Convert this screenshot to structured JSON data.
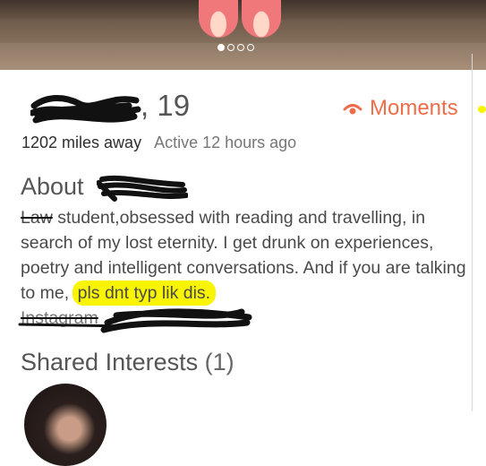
{
  "photo": {
    "dots": [
      true,
      false,
      false,
      false
    ]
  },
  "profile": {
    "name_suffix": ", 19",
    "distance": "1202 miles away",
    "active": "Active 12 hours ago"
  },
  "moments": {
    "label": "Moments",
    "color": "#ee6d4a",
    "icon": "eye-icon"
  },
  "about": {
    "heading": "About",
    "bio_struck": "Law",
    "bio_main": " student,obsessed with reading and travelling, in search of my lost eternity. I get drunk on experiences, poetry and intelligent conversations. And if you are talking to me, ",
    "bio_highlight": "pls dnt typ lik dis.",
    "instagram_struck": "Instagram"
  },
  "shared": {
    "heading": "Shared Interests",
    "count": "(1)"
  },
  "colors": {
    "highlight": "#f9f500",
    "accent": "#ee6d4a"
  }
}
